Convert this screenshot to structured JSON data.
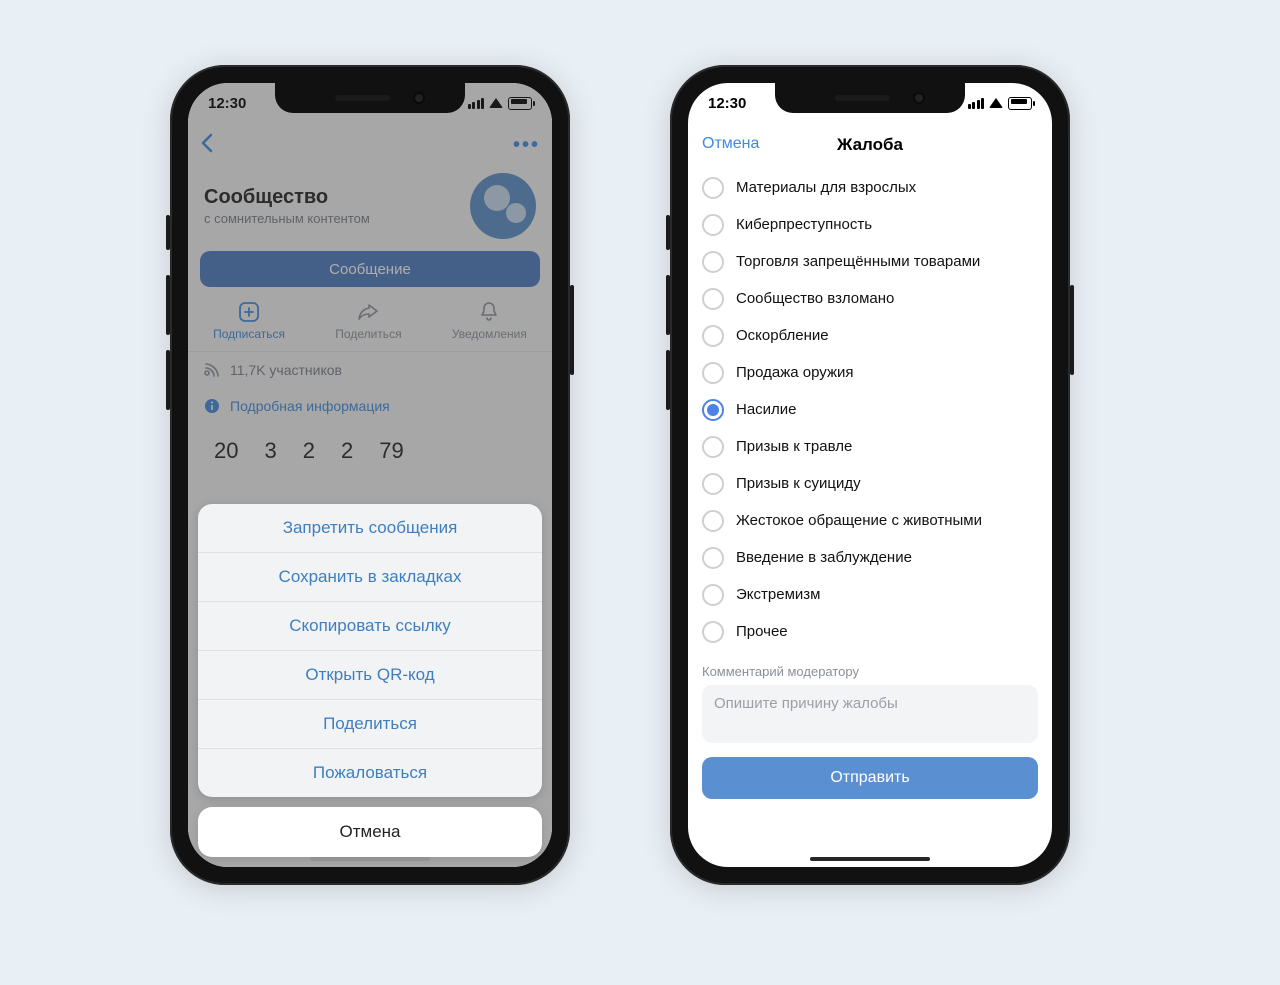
{
  "statusbar": {
    "time": "12:30"
  },
  "left": {
    "profile": {
      "title": "Сообщество",
      "subtitle": "с сомнительным контентом"
    },
    "message_button": "Сообщение",
    "actions": {
      "subscribe": "Подписаться",
      "share": "Поделиться",
      "notify": "Уведомления"
    },
    "members_line": "11,7K участников",
    "details_line": "Подробная информация",
    "stats": [
      "20",
      "3",
      "2",
      "2",
      "79"
    ],
    "sheet": [
      "Запретить сообщения",
      "Сохранить в закладках",
      "Скопировать ссылку",
      "Открыть QR-код",
      "Поделиться",
      "Пожаловаться"
    ],
    "cancel": "Отмена"
  },
  "right": {
    "cancel": "Отмена",
    "title": "Жалоба",
    "selected_index": 6,
    "reasons": [
      "Материалы для взрослых",
      "Киберпреступность",
      "Торговля запрещёнными товарами",
      "Сообщество взломано",
      "Оскорбление",
      "Продажа оружия",
      "Насилие",
      "Призыв к травле",
      "Призыв к суициду",
      "Жестокое обращение с животными",
      "Введение в заблуждение",
      "Экстремизм",
      "Прочее"
    ],
    "comment_label": "Комментарий модератору",
    "comment_placeholder": "Опишите причину жалобы",
    "send": "Отправить"
  }
}
